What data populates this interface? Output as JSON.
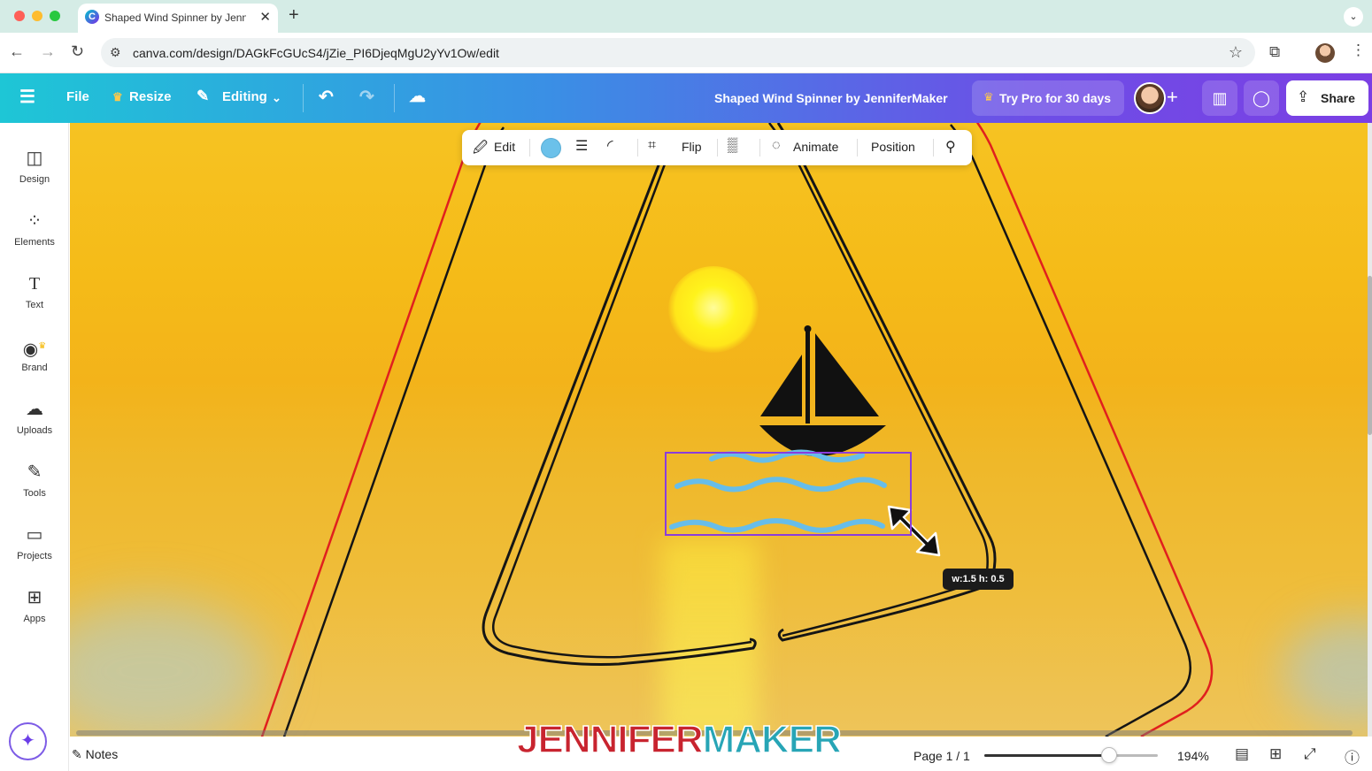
{
  "browser": {
    "tab_title": "Shaped Wind Spinner by Jennifer",
    "url": "canva.com/design/DAGkFcGUcS4/jZie_PI6DjeqMgU2yYv1Ow/edit"
  },
  "header": {
    "file": "File",
    "resize": "Resize",
    "editing": "Editing",
    "doc_title": "Shaped Wind Spinner by JenniferMaker",
    "try_pro": "Try Pro for 30 days",
    "share": "Share"
  },
  "sidebar": {
    "items": [
      {
        "label": "Design",
        "icon": "design-icon"
      },
      {
        "label": "Elements",
        "icon": "elements-icon"
      },
      {
        "label": "Text",
        "icon": "text-icon"
      },
      {
        "label": "Brand",
        "icon": "brand-icon"
      },
      {
        "label": "Uploads",
        "icon": "uploads-icon"
      },
      {
        "label": "Tools",
        "icon": "tools-icon"
      },
      {
        "label": "Projects",
        "icon": "projects-icon"
      },
      {
        "label": "Apps",
        "icon": "apps-icon"
      }
    ]
  },
  "context_toolbar": {
    "edit": "Edit",
    "color": "#6bc1ea",
    "flip": "Flip",
    "animate": "Animate",
    "position": "Position"
  },
  "canvas": {
    "dimensions_tooltip": "w:1.5 h: 0.5"
  },
  "footer": {
    "notes": "Notes",
    "page": "Page 1 / 1",
    "zoom": "194%",
    "zoom_fraction": 0.72
  },
  "watermark": {
    "part1": "JENNIFER",
    "part2": "MAKER"
  },
  "colors": {
    "accent": "#7d2ae8",
    "header_start": "#1ec6d6",
    "selection": "#8b3ddb",
    "cut_line": "#e0201e"
  }
}
